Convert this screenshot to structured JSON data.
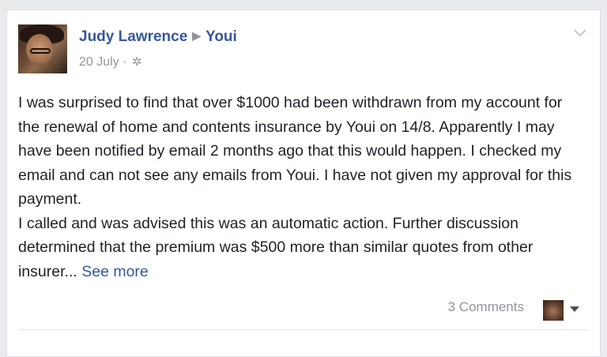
{
  "post": {
    "author": "Judy Lawrence",
    "target_page": "Youi",
    "date": "20 July",
    "date_separator": "·",
    "text_lines": [
      "I was surprised to find that over $1000 had been withdrawn from my account for the renewal of home and contents insurance by Youi on 14/8. Apparently I may have been notified by email 2 months ago that this would happen. I checked my email and can not see any emails from Youi. I have not given my approval for this payment.",
      "I called and was advised this was an automatic action. Further discussion determined that the premium was $500 more than similar quotes from other insurer..."
    ],
    "see_more": "See more",
    "comments": "3 Comments"
  },
  "icons": {
    "audience": "gear-icon",
    "arrow": "triangle-right-icon",
    "menu": "chevron-down-icon",
    "reaction_selector": "caret-down-icon"
  },
  "colors": {
    "link": "#365899",
    "meta": "#90949c",
    "text": "#1d2129",
    "background": "#e9ebee"
  }
}
